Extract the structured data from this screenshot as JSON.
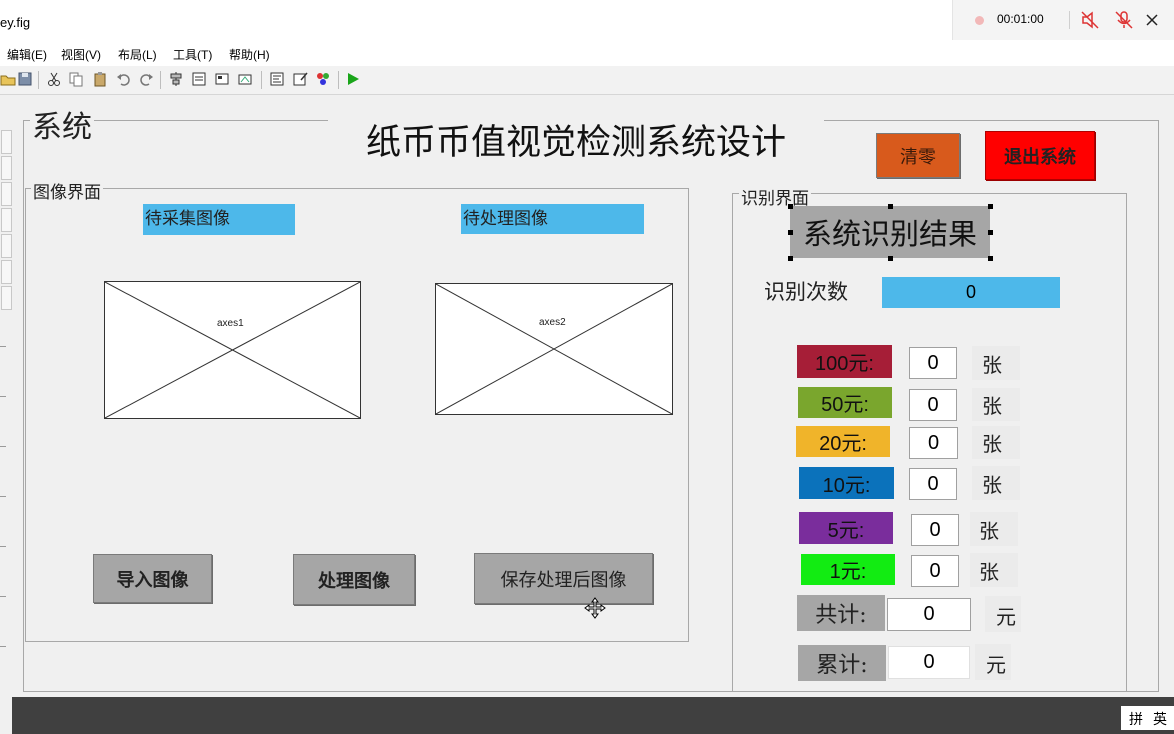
{
  "window": {
    "title_fragment": "ey.fig"
  },
  "recorder": {
    "time": "00:01:00"
  },
  "menu": [
    {
      "label": "编辑(E)"
    },
    {
      "label": "视图(V)"
    },
    {
      "label": "布局(L)"
    },
    {
      "label": "工具(T)"
    },
    {
      "label": "帮助(H)"
    }
  ],
  "gui": {
    "system_panel_title": "系统",
    "main_title": "纸币币值视觉检测系统设计",
    "clear_button": "清零",
    "exit_button": "退出系统",
    "image_panel": {
      "title": "图像界面",
      "label_left": "待采集图像",
      "label_right": "待处理图像",
      "axes1": "axes1",
      "axes2": "axes2",
      "import_button": "导入图像",
      "process_button": "处理图像",
      "save_button": "保存处理后图像"
    },
    "recog_panel": {
      "title": "识别界面",
      "result_title": "系统识别结果",
      "count_label": "识别次数",
      "count_value": "0",
      "denominations": [
        {
          "label": "100元:",
          "value": "0",
          "unit": "张",
          "color": "#a61e37"
        },
        {
          "label": "50元:",
          "value": "0",
          "unit": "张",
          "color": "#7aa62d"
        },
        {
          "label": "20元:",
          "value": "0",
          "unit": "张",
          "color": "#f0b42a"
        },
        {
          "label": "10元:",
          "value": "0",
          "unit": "张",
          "color": "#0b72bb"
        },
        {
          "label": "5元:",
          "value": "0",
          "unit": "张",
          "color": "#7a2d9c"
        },
        {
          "label": "1元:",
          "value": "0",
          "unit": "张",
          "color": "#12ec12"
        }
      ],
      "total_label": "共计:",
      "total_value": "0",
      "total_unit": "元",
      "cumulative_label": "累计:",
      "cumulative_value": "0",
      "cumulative_unit": "元"
    }
  },
  "ime": {
    "left": "拼",
    "right": "英"
  },
  "colors": {
    "label_blue": "#4db8ea",
    "clear_button": "#d85a1c",
    "exit_button": "#ff0000",
    "button_gray": "#a6a6a6",
    "play_green": "#1aa51a"
  }
}
